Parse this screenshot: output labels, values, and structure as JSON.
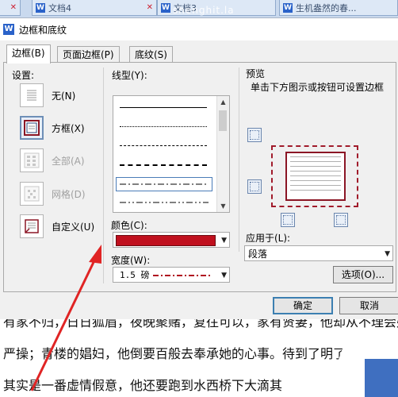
{
  "tabs": [
    {
      "label": "文档4"
    },
    {
      "label": "文档3"
    },
    {
      "label": "生机盎然的春..."
    }
  ],
  "watermark": "shenghit.la",
  "dialog": {
    "title": "边框和底纹",
    "tabs": [
      "边框(B)",
      "页面边框(P)",
      "底纹(S)"
    ],
    "settings_label": "设置:",
    "settings": [
      {
        "label": "无(N)"
      },
      {
        "label": "方框(X)"
      },
      {
        "label": "全部(A)"
      },
      {
        "label": "网格(D)"
      },
      {
        "label": "自定义(U)"
      }
    ],
    "line_style_label": "线型(Y):",
    "color_label": "颜色(C):",
    "color_value": "#c0101e",
    "width_label": "宽度(W):",
    "width_value": "1.5  磅",
    "preview_label": "预览",
    "preview_hint": "单击下方图示或按钮可设置边框",
    "apply_to_label": "应用于(L):",
    "apply_to_value": "段落",
    "options_button": "选项(O)...",
    "ok_button": "确定",
    "cancel_button": "取消"
  },
  "document": {
    "line1": "有家不归，日日狐眉，夜晚聚赌，复往可以，家有贤妻，他却从不理会她",
    "line2": "严操；青楼的娼妇，他倒要百般去奉承她的心事。待到了明了那",
    "line3": "其实是一番虚情假意，他还要跑到水西桥下大滴其"
  }
}
